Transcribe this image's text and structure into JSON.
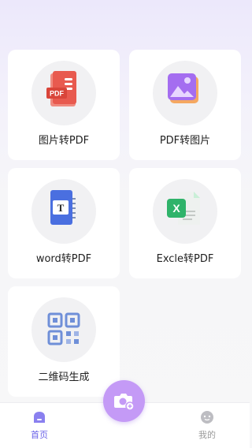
{
  "tools": [
    {
      "label": "图片转PDF",
      "icon": "image-to-pdf-icon"
    },
    {
      "label": "PDF转图片",
      "icon": "pdf-to-image-icon"
    },
    {
      "label": "word转PDF",
      "icon": "word-to-pdf-icon"
    },
    {
      "label": "Excle转PDF",
      "icon": "excel-to-pdf-icon"
    },
    {
      "label": "二维码生成",
      "icon": "qr-code-icon"
    }
  ],
  "tabbar": {
    "home_label": "首页",
    "mine_label": "我的",
    "camera_icon": "camera-icon"
  },
  "colors": {
    "accent": "#6b63e8",
    "fab": "#c49af6",
    "pdf_red": "#e85a4f",
    "image_purple": "#a46df0",
    "word_blue": "#4a6fe0",
    "excel_green": "#2fb36a",
    "qr_blue": "#6f8fd8"
  }
}
